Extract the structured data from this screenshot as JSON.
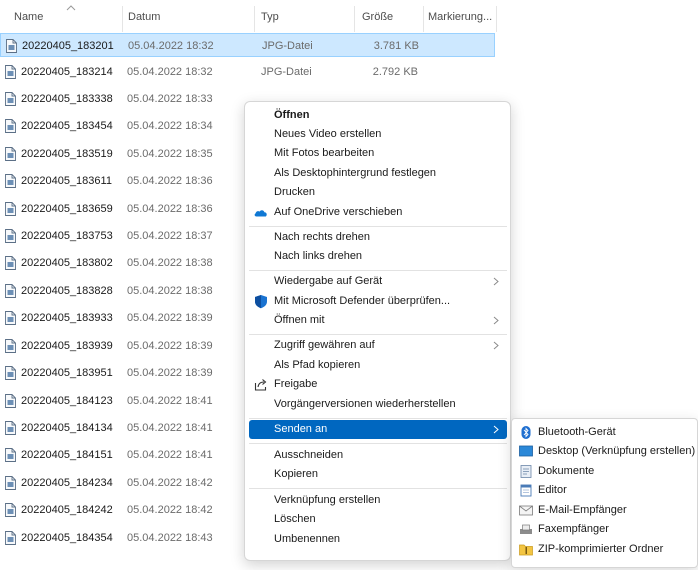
{
  "columns": {
    "name": "Name",
    "date": "Datum",
    "type": "Typ",
    "size": "Größe",
    "tags": "Markierung..."
  },
  "files": [
    {
      "name": "20220405_183201",
      "date": "05.04.2022 18:32",
      "type": "JPG-Datei",
      "size": "3.781 KB",
      "selected": true
    },
    {
      "name": "20220405_183214",
      "date": "05.04.2022 18:32",
      "type": "JPG-Datei",
      "size": "2.792 KB"
    },
    {
      "name": "20220405_183338",
      "date": "05.04.2022 18:33",
      "type": "",
      "size": ""
    },
    {
      "name": "20220405_183454",
      "date": "05.04.2022 18:34"
    },
    {
      "name": "20220405_183519",
      "date": "05.04.2022 18:35"
    },
    {
      "name": "20220405_183611",
      "date": "05.04.2022 18:36"
    },
    {
      "name": "20220405_183659",
      "date": "05.04.2022 18:36"
    },
    {
      "name": "20220405_183753",
      "date": "05.04.2022 18:37"
    },
    {
      "name": "20220405_183802",
      "date": "05.04.2022 18:38"
    },
    {
      "name": "20220405_183828",
      "date": "05.04.2022 18:38"
    },
    {
      "name": "20220405_183933",
      "date": "05.04.2022 18:39"
    },
    {
      "name": "20220405_183939",
      "date": "05.04.2022 18:39"
    },
    {
      "name": "20220405_183951",
      "date": "05.04.2022 18:39"
    },
    {
      "name": "20220405_184123",
      "date": "05.04.2022 18:41"
    },
    {
      "name": "20220405_184134",
      "date": "05.04.2022 18:41"
    },
    {
      "name": "20220405_184151",
      "date": "05.04.2022 18:41"
    },
    {
      "name": "20220405_184234",
      "date": "05.04.2022 18:42"
    },
    {
      "name": "20220405_184242",
      "date": "05.04.2022 18:42"
    },
    {
      "name": "20220405_184354",
      "date": "05.04.2022 18:43"
    }
  ],
  "context_menu": {
    "open": "Öffnen",
    "new_video": "Neues Video erstellen",
    "edit_photos": "Mit Fotos bearbeiten",
    "set_desktop_bg": "Als Desktophintergrund festlegen",
    "print": "Drucken",
    "move_onedrive": "Auf OneDrive verschieben",
    "rotate_right": "Nach rechts drehen",
    "rotate_left": "Nach links drehen",
    "play_to_device": "Wiedergabe auf Gerät",
    "defender_scan": "Mit Microsoft Defender überprüfen...",
    "open_with": "Öffnen mit",
    "give_access": "Zugriff gewähren auf",
    "copy_path": "Als Pfad kopieren",
    "share": "Freigabe",
    "restore_versions": "Vorgängerversionen wiederherstellen",
    "send_to": "Senden an",
    "cut": "Ausschneiden",
    "copy": "Kopieren",
    "create_shortcut": "Verknüpfung erstellen",
    "delete": "Löschen",
    "rename": "Umbenennen"
  },
  "send_to_menu": {
    "bluetooth": "Bluetooth-Gerät",
    "desktop": "Desktop (Verknüpfung erstellen)",
    "documents": "Dokumente",
    "editor": "Editor",
    "mail": "E-Mail-Empfänger",
    "fax": "Faxempfänger",
    "zip": "ZIP-komprimierter Ordner"
  },
  "colors": {
    "selection_bg": "#cde8ff",
    "menu_highlight": "#0067c0",
    "onedrive": "#0f78d4",
    "defender": "#1a73d1"
  }
}
